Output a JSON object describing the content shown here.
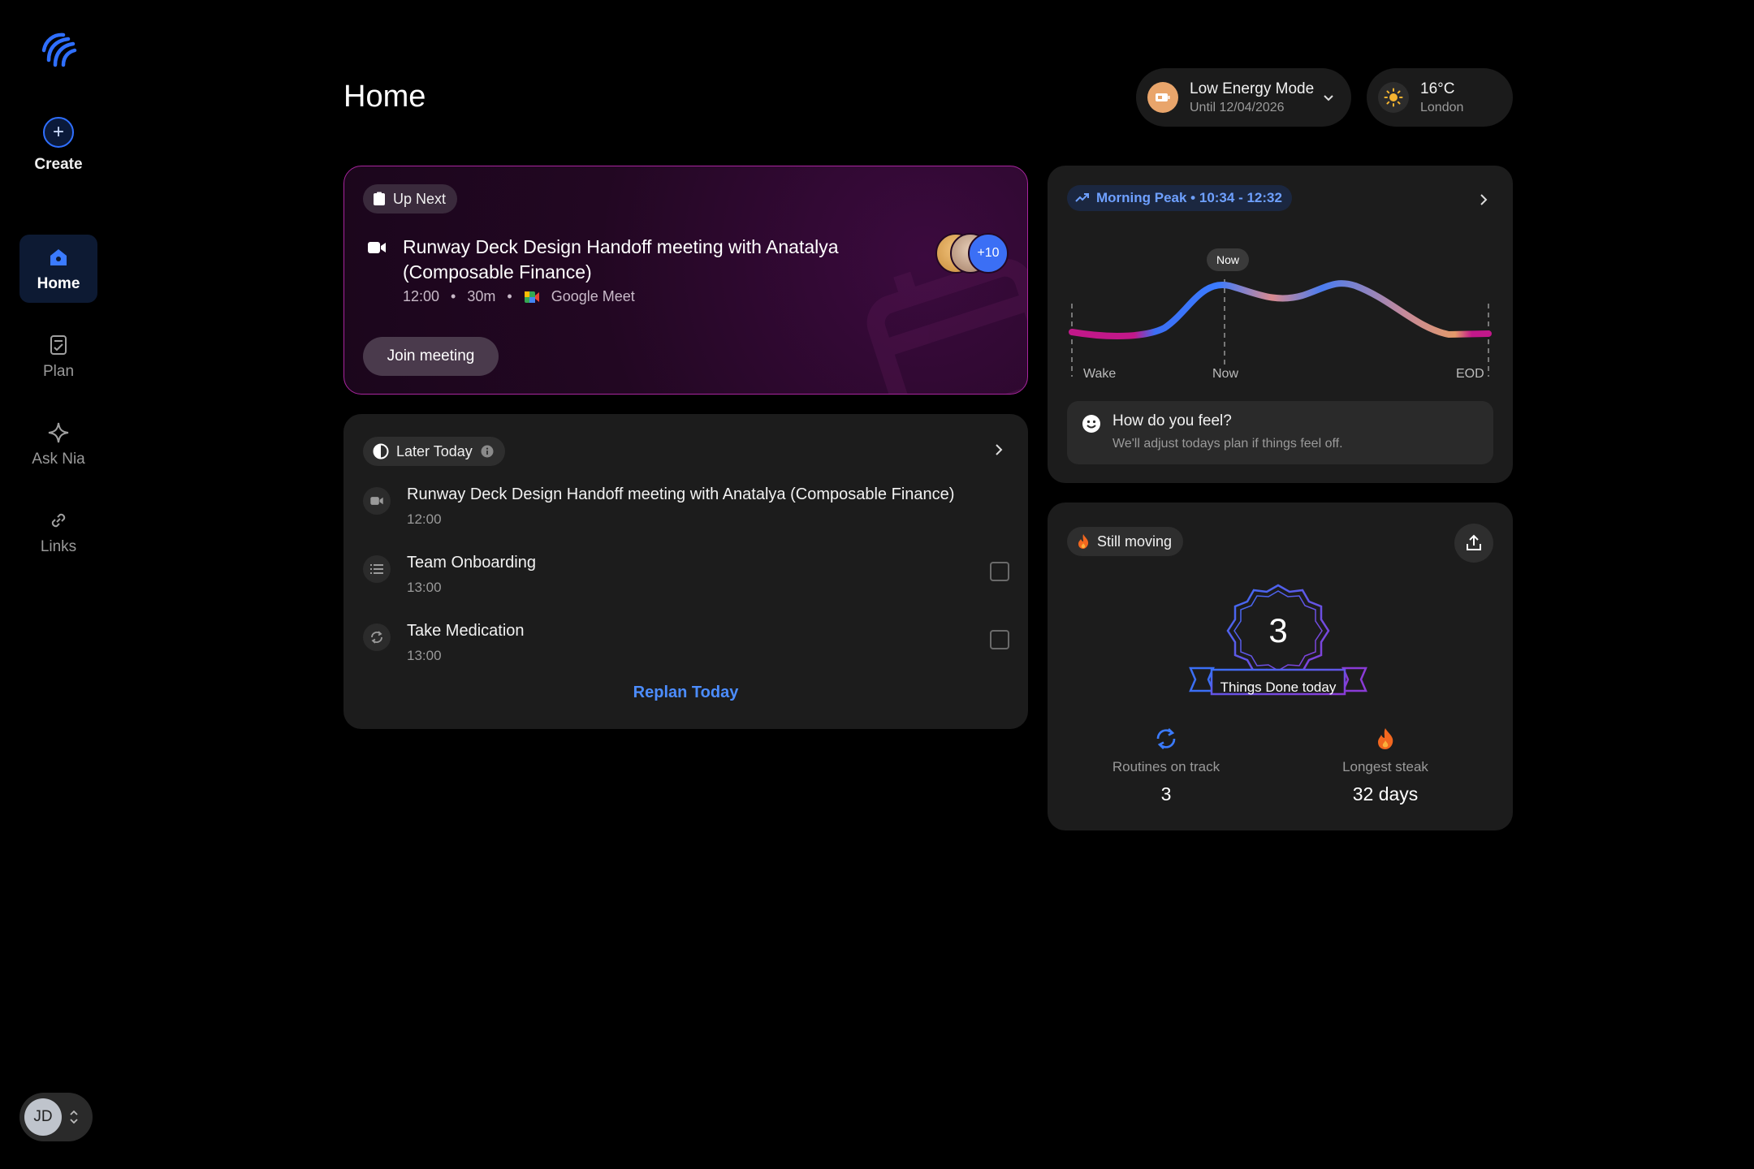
{
  "sidebar": {
    "create_label": "Create",
    "items": [
      {
        "label": "Home",
        "icon": "home-icon"
      },
      {
        "label": "Plan",
        "icon": "plan-icon"
      },
      {
        "label": "Ask Nia",
        "icon": "sparkle-icon"
      },
      {
        "label": "Links",
        "icon": "link-icon"
      }
    ],
    "user_initials": "JD"
  },
  "header": {
    "title": "Home",
    "energy_mode": {
      "label": "Low Energy Mode",
      "until": "Until 12/04/2026"
    },
    "weather": {
      "temp": "16°C",
      "location": "London"
    }
  },
  "up_next": {
    "chip": "Up Next",
    "title": "Runway Deck Design Handoff meeting with Anatalya (Composable Finance)",
    "time": "12:00",
    "duration": "30m",
    "platform": "Google Meet",
    "extra_attendees": "+10",
    "join_label": "Join meeting"
  },
  "later_today": {
    "chip": "Later Today",
    "tasks": [
      {
        "title": "Runway Deck Design Handoff meeting with Anatalya (Composable Finance)",
        "time": "12:00",
        "icon": "video-icon",
        "checkbox": false
      },
      {
        "title": "Team Onboarding",
        "time": "13:00",
        "icon": "list-icon",
        "checkbox": true
      },
      {
        "title": "Take Medication",
        "time": "13:00",
        "icon": "repeat-icon",
        "checkbox": true
      }
    ],
    "replan_label": "Replan Today"
  },
  "peak": {
    "chip": "Morning Peak • 10:34 - 12:32",
    "now_tag": "Now",
    "x_labels": {
      "wake": "Wake",
      "now": "Now",
      "eod": "EOD"
    },
    "feel_title": "How do you feel?",
    "feel_sub": "We'll adjust todays plan if things feel off."
  },
  "moving": {
    "chip": "Still moving",
    "count": "3",
    "count_label": "Things Done today",
    "stats": [
      {
        "label": "Routines on track",
        "value": "3",
        "icon": "repeat-icon"
      },
      {
        "label": "Longest steak",
        "value": "32 days",
        "icon": "flame-icon"
      }
    ]
  },
  "colors": {
    "accent": "#3b6ff5",
    "link": "#4c8dff",
    "magenta": "#c2188a",
    "peach": "#e9a56b"
  }
}
